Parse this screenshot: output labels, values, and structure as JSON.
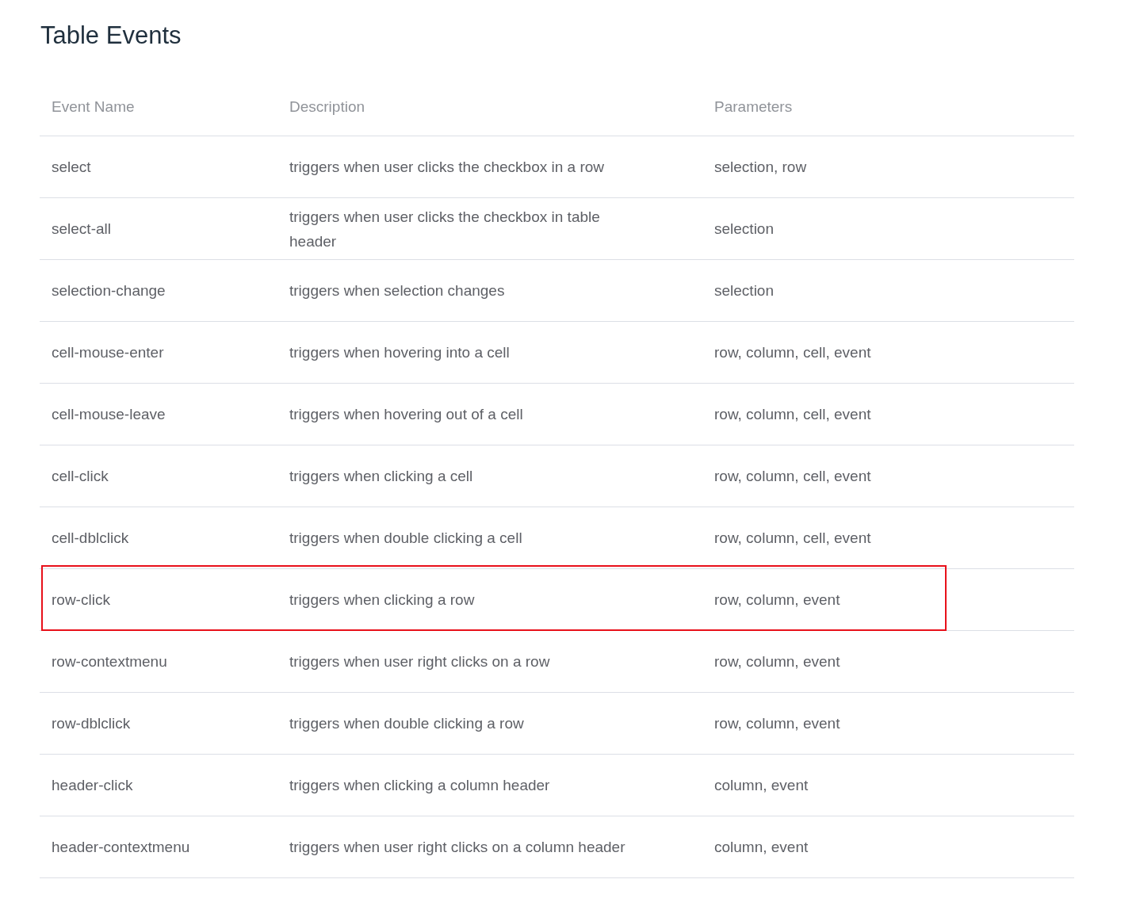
{
  "title": "Table Events",
  "table": {
    "columns": [
      "Event Name",
      "Description",
      "Parameters"
    ],
    "rows": [
      {
        "cells": [
          "select",
          "triggers when user clicks the checkbox in a row",
          "selection, row"
        ],
        "highlighted": false
      },
      {
        "cells": [
          "select-all",
          "triggers when user clicks the checkbox in table header",
          "selection"
        ],
        "highlighted": false
      },
      {
        "cells": [
          "selection-change",
          "triggers when selection changes",
          "selection"
        ],
        "highlighted": false
      },
      {
        "cells": [
          "cell-mouse-enter",
          "triggers when hovering into a cell",
          "row, column, cell, event"
        ],
        "highlighted": false
      },
      {
        "cells": [
          "cell-mouse-leave",
          "triggers when hovering out of a cell",
          "row, column, cell, event"
        ],
        "highlighted": false
      },
      {
        "cells": [
          "cell-click",
          "triggers when clicking a cell",
          "row, column, cell, event"
        ],
        "highlighted": false
      },
      {
        "cells": [
          "cell-dblclick",
          "triggers when double clicking a cell",
          "row, column, cell, event"
        ],
        "highlighted": false
      },
      {
        "cells": [
          "row-click",
          "triggers when clicking a row",
          "row, column, event"
        ],
        "highlighted": true
      },
      {
        "cells": [
          "row-contextmenu",
          "triggers when user right clicks on a row",
          "row, column, event"
        ],
        "highlighted": false
      },
      {
        "cells": [
          "row-dblclick",
          "triggers when double clicking a row",
          "row, column, event"
        ],
        "highlighted": false
      },
      {
        "cells": [
          "header-click",
          "triggers when clicking a column header",
          "column, event"
        ],
        "highlighted": false
      },
      {
        "cells": [
          "header-contextmenu",
          "triggers when user right clicks on a column header",
          "column, event"
        ],
        "highlighted": false
      }
    ]
  }
}
